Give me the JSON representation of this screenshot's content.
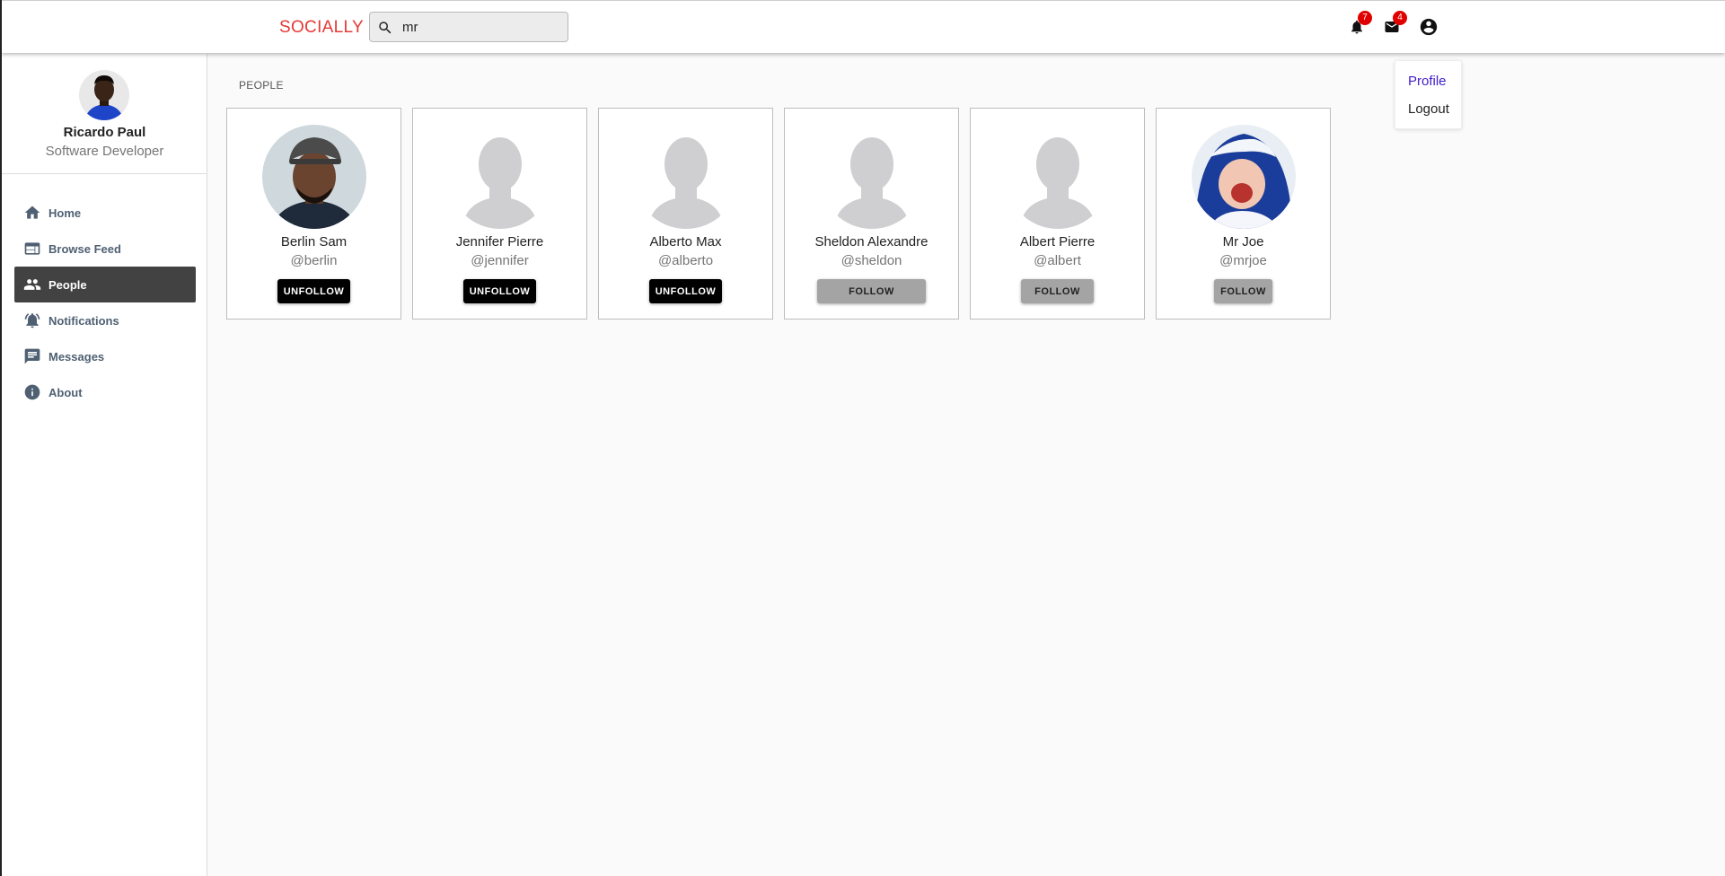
{
  "brand": "SOCIALLY",
  "search": {
    "value": "mr",
    "placeholder": ""
  },
  "topbar": {
    "notifications_count": "7",
    "messages_count": "4"
  },
  "sidebar": {
    "profile": {
      "name": "Ricardo Paul",
      "role": "Software Developer"
    },
    "items": [
      {
        "label": "Home",
        "icon": "home-icon",
        "active": false
      },
      {
        "label": "Browse Feed",
        "icon": "feed-icon",
        "active": false
      },
      {
        "label": "People",
        "icon": "people-icon",
        "active": true
      },
      {
        "label": "Notifications",
        "icon": "notifications-icon",
        "active": false
      },
      {
        "label": "Messages",
        "icon": "messages-icon",
        "active": false
      },
      {
        "label": "About",
        "icon": "info-icon",
        "active": false
      }
    ]
  },
  "user_menu": {
    "profile": "Profile",
    "logout": "Logout"
  },
  "main": {
    "section_title": "PEOPLE",
    "people": [
      {
        "name": "Berlin Sam",
        "handle": "@berlin",
        "button": "UNFOLLOW",
        "avatar": "photo"
      },
      {
        "name": "Jennifer Pierre",
        "handle": "@jennifer",
        "button": "UNFOLLOW",
        "avatar": "placeholder"
      },
      {
        "name": "Alberto Max",
        "handle": "@alberto",
        "button": "UNFOLLOW",
        "avatar": "placeholder"
      },
      {
        "name": "Sheldon Alexandre",
        "handle": "@sheldon",
        "button": "FOLLOW",
        "avatar": "placeholder"
      },
      {
        "name": "Albert Pierre",
        "handle": "@albert",
        "button": "FOLLOW",
        "avatar": "placeholder"
      },
      {
        "name": "Mr Joe",
        "handle": "@mrjoe",
        "button": "FOLLOW",
        "avatar": "photo"
      }
    ]
  },
  "colors": {
    "brand": "#e53935",
    "active_nav": "#424242",
    "badge": "#e00000",
    "menu_link": "#3f1dcb"
  }
}
